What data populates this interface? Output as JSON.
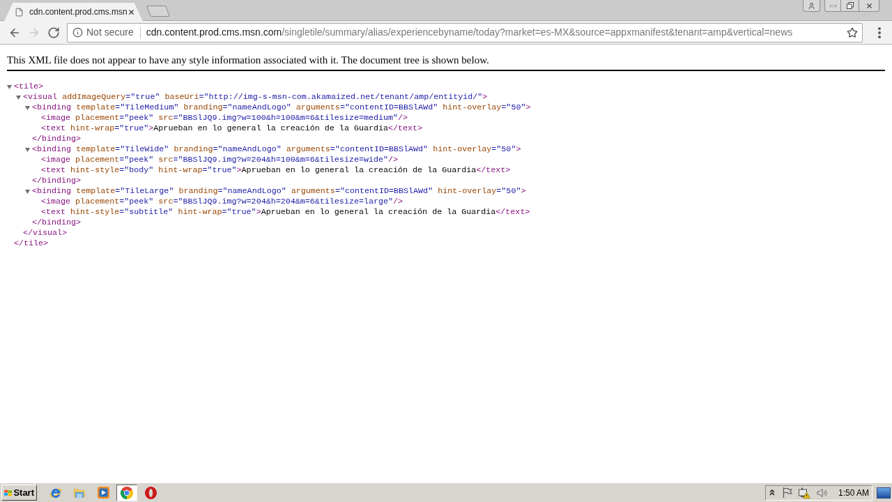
{
  "browser": {
    "tabs": [
      {
        "title": "cdn.content.prod.cms.msn",
        "selected": true
      }
    ],
    "nav_buttons": [
      {
        "kind": "back",
        "disabled": false
      },
      {
        "kind": "forward",
        "disabled": true
      },
      {
        "kind": "reload",
        "disabled": false
      }
    ],
    "address_bar": {
      "security_label": "Not secure",
      "url_host": "cdn.content.prod.cms.msn.com",
      "url_path": "/singletile/summary/alias/experiencebyname/today?market=es-MX&source=appxmanifest&tenant=amp&vertical=news",
      "bookmarked": false
    }
  },
  "page": {
    "notice": "This XML file does not appear to have any style information associated with it. The document tree is shown below.",
    "tree": {
      "kind": "element",
      "open": [
        {
          "kind": "tag",
          "text": "<tile>"
        }
      ],
      "expanded": true,
      "children": [
        {
          "kind": "element",
          "open": [
            {
              "kind": "tag",
              "text": "<visual"
            },
            {
              "kind": "attr",
              "text": "addImageQuery"
            },
            {
              "kind": "value",
              "text": "=\"true\""
            },
            {
              "kind": "attr",
              "text": "baseUri"
            },
            {
              "kind": "value",
              "text": "=\"http://img-s-msn-com.akamaized.net/tenant/amp/entityid/\""
            },
            {
              "kind": "tag",
              "text": ">"
            }
          ],
          "expanded": true,
          "children": [
            {
              "kind": "element",
              "open": [
                {
                  "kind": "tag",
                  "text": "<binding"
                },
                {
                  "kind": "attr",
                  "text": "template"
                },
                {
                  "kind": "value",
                  "text": "=\"TileMedium\""
                },
                {
                  "kind": "attr",
                  "text": "branding"
                },
                {
                  "kind": "value",
                  "text": "=\"nameAndLogo\""
                },
                {
                  "kind": "attr",
                  "text": "arguments"
                },
                {
                  "kind": "value",
                  "text": "=\"contentID=BBSlAWd\""
                },
                {
                  "kind": "attr",
                  "text": "hint-overlay"
                },
                {
                  "kind": "value",
                  "text": "=\"50\""
                },
                {
                  "kind": "tag",
                  "text": ">"
                }
              ],
              "expanded": true,
              "children": [
                {
                  "kind": "line",
                  "line": [
                    {
                      "kind": "tag",
                      "text": "<image"
                    },
                    {
                      "kind": "attr",
                      "text": "placement"
                    },
                    {
                      "kind": "value",
                      "text": "=\"peek\""
                    },
                    {
                      "kind": "attr",
                      "text": "src"
                    },
                    {
                      "kind": "value",
                      "text": "=\"BBSlJQ9.img?w=100&h=100&m=6&tilesize=medium\""
                    },
                    {
                      "kind": "tag",
                      "text": "/>"
                    }
                  ]
                },
                {
                  "kind": "line",
                  "line": [
                    {
                      "kind": "tag",
                      "text": "<text"
                    },
                    {
                      "kind": "attr",
                      "text": "hint-wrap"
                    },
                    {
                      "kind": "value",
                      "text": "=\"true\""
                    },
                    {
                      "kind": "tag",
                      "text": ">"
                    },
                    {
                      "kind": "text",
                      "text": "Aprueban en lo general la creación de la Guardia"
                    },
                    {
                      "kind": "tag",
                      "text": "</text>"
                    }
                  ]
                }
              ],
              "close": [
                {
                  "kind": "tag",
                  "text": "</binding>"
                }
              ]
            },
            {
              "kind": "element",
              "open": [
                {
                  "kind": "tag",
                  "text": "<binding"
                },
                {
                  "kind": "attr",
                  "text": "template"
                },
                {
                  "kind": "value",
                  "text": "=\"TileWide\""
                },
                {
                  "kind": "attr",
                  "text": "branding"
                },
                {
                  "kind": "value",
                  "text": "=\"nameAndLogo\""
                },
                {
                  "kind": "attr",
                  "text": "arguments"
                },
                {
                  "kind": "value",
                  "text": "=\"contentID=BBSlAWd\""
                },
                {
                  "kind": "attr",
                  "text": "hint-overlay"
                },
                {
                  "kind": "value",
                  "text": "=\"50\""
                },
                {
                  "kind": "tag",
                  "text": ">"
                }
              ],
              "expanded": true,
              "children": [
                {
                  "kind": "line",
                  "line": [
                    {
                      "kind": "tag",
                      "text": "<image"
                    },
                    {
                      "kind": "attr",
                      "text": "placement"
                    },
                    {
                      "kind": "value",
                      "text": "=\"peek\""
                    },
                    {
                      "kind": "attr",
                      "text": "src"
                    },
                    {
                      "kind": "value",
                      "text": "=\"BBSlJQ9.img?w=204&h=100&m=6&tilesize=wide\""
                    },
                    {
                      "kind": "tag",
                      "text": "/>"
                    }
                  ]
                },
                {
                  "kind": "line",
                  "line": [
                    {
                      "kind": "tag",
                      "text": "<text"
                    },
                    {
                      "kind": "attr",
                      "text": "hint-style"
                    },
                    {
                      "kind": "value",
                      "text": "=\"body\""
                    },
                    {
                      "kind": "attr",
                      "text": "hint-wrap"
                    },
                    {
                      "kind": "value",
                      "text": "=\"true\""
                    },
                    {
                      "kind": "tag",
                      "text": ">"
                    },
                    {
                      "kind": "text",
                      "text": "Aprueban en lo general la creación de la Guardia"
                    },
                    {
                      "kind": "tag",
                      "text": "</text>"
                    }
                  ]
                }
              ],
              "close": [
                {
                  "kind": "tag",
                  "text": "</binding>"
                }
              ]
            },
            {
              "kind": "element",
              "open": [
                {
                  "kind": "tag",
                  "text": "<binding"
                },
                {
                  "kind": "attr",
                  "text": "template"
                },
                {
                  "kind": "value",
                  "text": "=\"TileLarge\""
                },
                {
                  "kind": "attr",
                  "text": "branding"
                },
                {
                  "kind": "value",
                  "text": "=\"nameAndLogo\""
                },
                {
                  "kind": "attr",
                  "text": "arguments"
                },
                {
                  "kind": "value",
                  "text": "=\"contentID=BBSlAWd\""
                },
                {
                  "kind": "attr",
                  "text": "hint-overlay"
                },
                {
                  "kind": "value",
                  "text": "=\"50\""
                },
                {
                  "kind": "tag",
                  "text": ">"
                }
              ],
              "expanded": true,
              "children": [
                {
                  "kind": "line",
                  "line": [
                    {
                      "kind": "tag",
                      "text": "<image"
                    },
                    {
                      "kind": "attr",
                      "text": "placement"
                    },
                    {
                      "kind": "value",
                      "text": "=\"peek\""
                    },
                    {
                      "kind": "attr",
                      "text": "src"
                    },
                    {
                      "kind": "value",
                      "text": "=\"BBSlJQ9.img?w=204&h=204&m=6&tilesize=large\""
                    },
                    {
                      "kind": "tag",
                      "text": "/>"
                    }
                  ]
                },
                {
                  "kind": "line",
                  "line": [
                    {
                      "kind": "tag",
                      "text": "<text"
                    },
                    {
                      "kind": "attr",
                      "text": "hint-style"
                    },
                    {
                      "kind": "value",
                      "text": "=\"subtitle\""
                    },
                    {
                      "kind": "attr",
                      "text": "hint-wrap"
                    },
                    {
                      "kind": "value",
                      "text": "=\"true\""
                    },
                    {
                      "kind": "tag",
                      "text": ">"
                    },
                    {
                      "kind": "text",
                      "text": "Aprueban en lo general la creación de la Guardia"
                    },
                    {
                      "kind": "tag",
                      "text": "</text>"
                    }
                  ]
                }
              ],
              "close": [
                {
                  "kind": "tag",
                  "text": "</binding>"
                }
              ]
            }
          ],
          "close": [
            {
              "kind": "tag",
              "text": "</visual>"
            }
          ]
        }
      ],
      "close": [
        {
          "kind": "tag",
          "text": "</tile>"
        }
      ]
    }
  },
  "taskbar": {
    "start_label": "Start",
    "apps": [
      {
        "kind": "ie",
        "selected": false
      },
      {
        "kind": "explorer",
        "selected": false
      },
      {
        "kind": "media-player",
        "selected": false
      },
      {
        "kind": "chrome",
        "selected": true
      },
      {
        "kind": "opera",
        "selected": false
      }
    ],
    "clock": "1:50 AM"
  }
}
